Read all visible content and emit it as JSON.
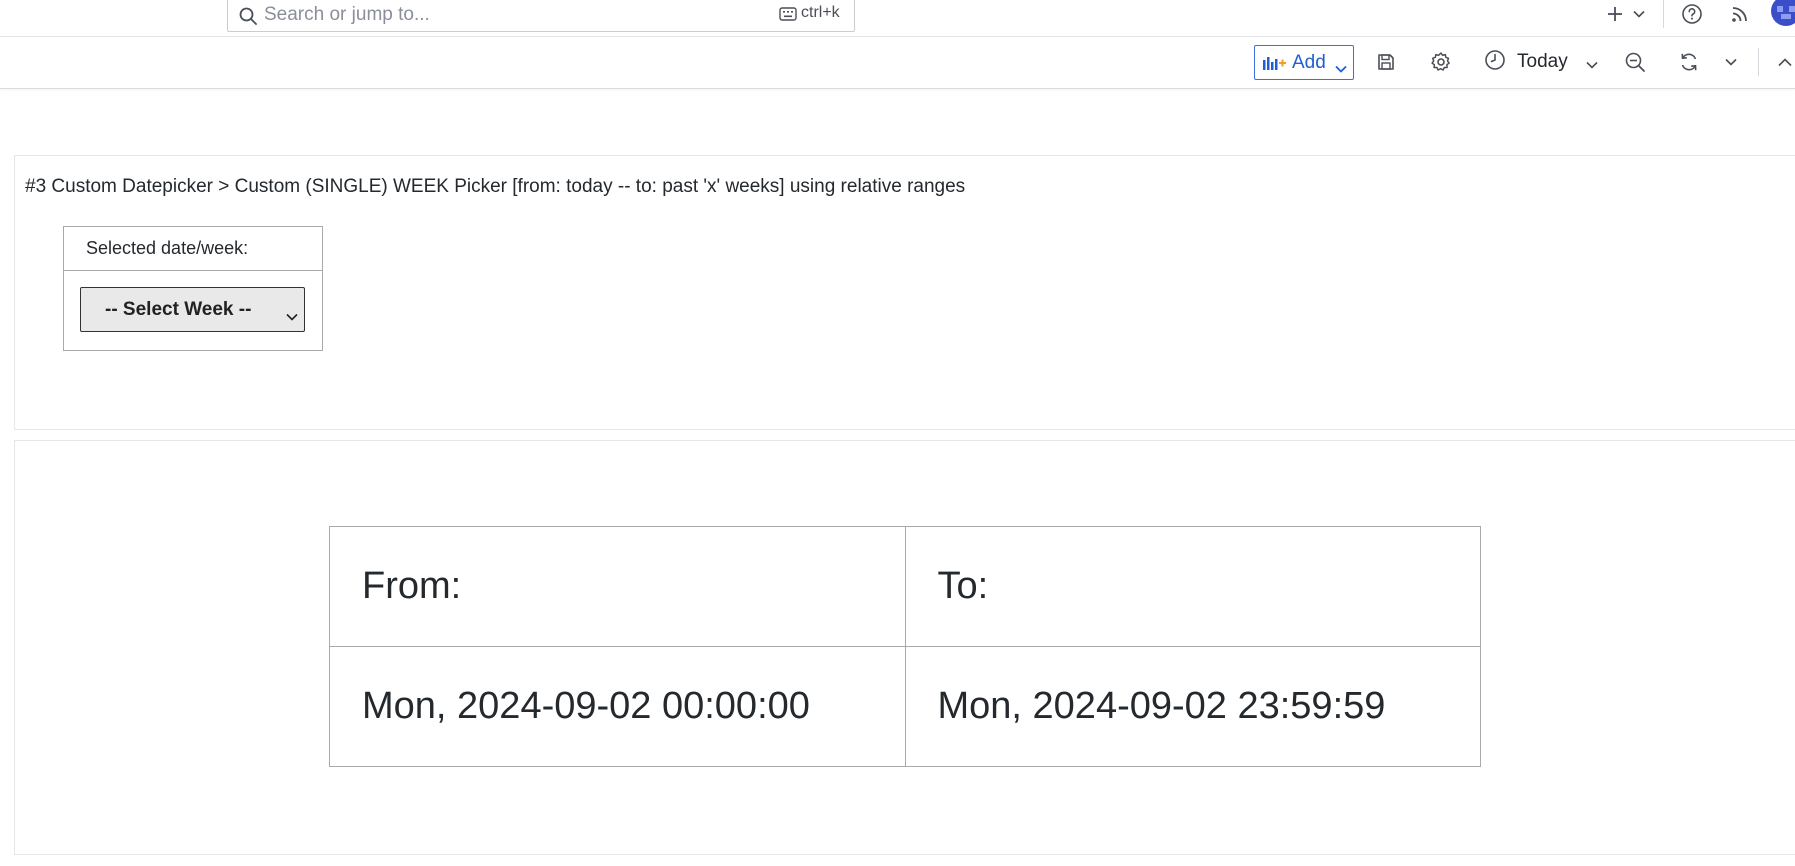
{
  "search": {
    "placeholder": "Search or jump to...",
    "shortcut": "ctrl+k"
  },
  "toolbar": {
    "add_label": "Add",
    "time_range_label": "Today"
  },
  "panel1": {
    "title": "#3 Custom Datepicker > Custom (SINGLE) WEEK Picker [from: today -- to: past 'x' weeks] using relative ranges",
    "picker_header": "Selected date/week:",
    "select_value": "-- Select Week --"
  },
  "panel2": {
    "from_label": "From:",
    "to_label": "To:",
    "from_value": "Mon, 2024-09-02 00:00:00",
    "to_value": "Mon, 2024-09-02 23:59:59"
  },
  "colors": {
    "accent": "#3d71d9",
    "text": "#24292e",
    "border": "#aaaaaa",
    "select_bg": "#e9e9ea"
  },
  "icons": [
    "search-icon",
    "keyboard-icon",
    "plus-icon",
    "chevron-down-icon",
    "help-icon",
    "rss-icon",
    "avatar",
    "bar-chart-add-icon",
    "save-icon",
    "gear-icon",
    "clock-icon",
    "zoom-out-icon",
    "refresh-icon",
    "chevron-up-icon"
  ]
}
